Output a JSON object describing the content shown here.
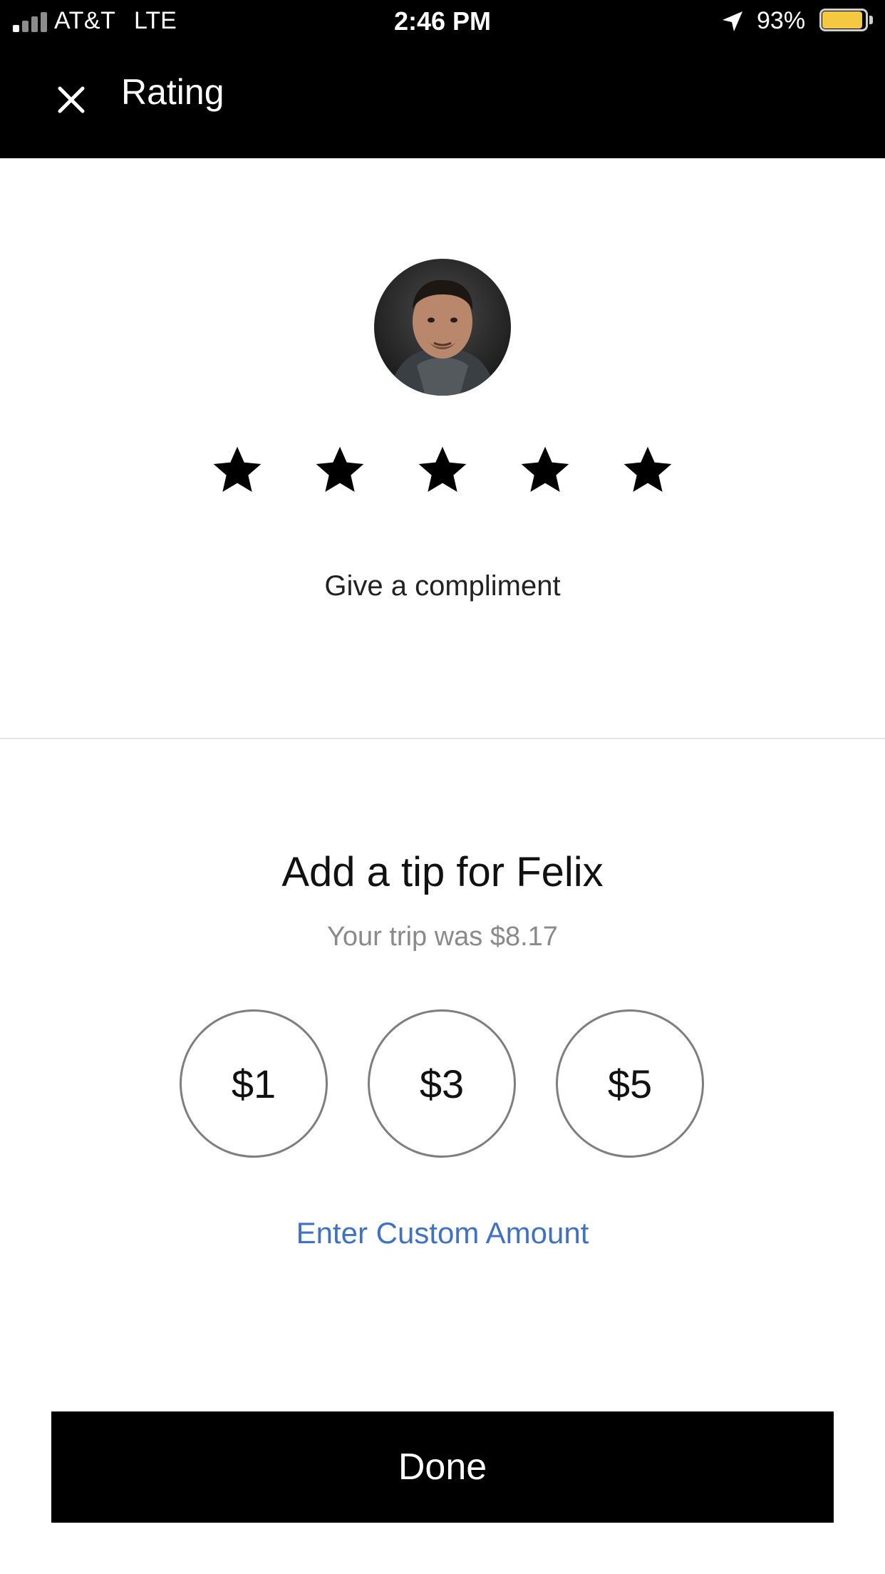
{
  "status_bar": {
    "carrier": "AT&T",
    "network": "LTE",
    "time": "2:46 PM",
    "battery_percent": "93%",
    "battery_level": 0.93,
    "battery_color": "#f5c842"
  },
  "nav": {
    "title": "Rating",
    "close_icon": "close-icon"
  },
  "rating": {
    "driver_photo": "driver-avatar",
    "stars": 5,
    "star_icon": "star-icon",
    "compliment_label": "Give a compliment"
  },
  "tip": {
    "title": "Add a tip for Felix",
    "subtitle": "Your trip was $8.17",
    "options": [
      "$1",
      "$3",
      "$5"
    ],
    "custom_label": "Enter Custom Amount",
    "link_color": "#3f72c4"
  },
  "footer": {
    "done_label": "Done"
  }
}
